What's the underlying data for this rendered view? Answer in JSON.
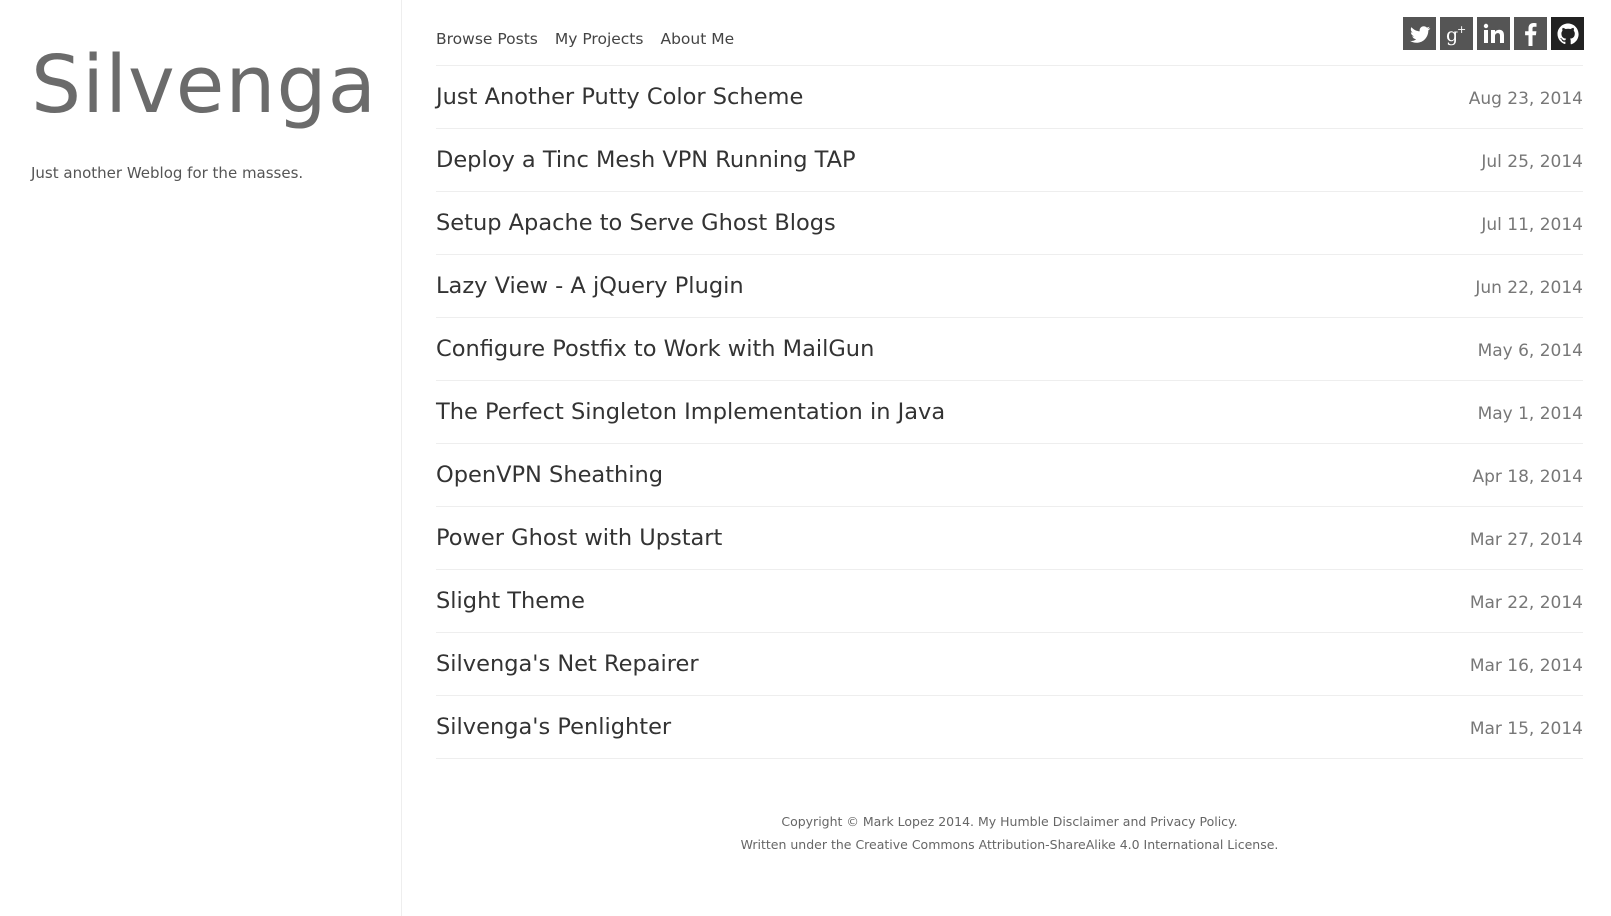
{
  "site": {
    "title": "Silvenga",
    "tagline": "Just another Weblog for the masses."
  },
  "nav": {
    "items": [
      {
        "label": "Browse Posts"
      },
      {
        "label": "My Projects"
      },
      {
        "label": "About Me"
      }
    ]
  },
  "social": {
    "icons": [
      "twitter-icon",
      "google-plus-icon",
      "linkedin-icon",
      "facebook-icon",
      "github-icon"
    ]
  },
  "posts": [
    {
      "title": "Just Another Putty Color Scheme",
      "date": "Aug 23, 2014"
    },
    {
      "title": "Deploy a Tinc Mesh VPN Running TAP",
      "date": "Jul 25, 2014"
    },
    {
      "title": "Setup Apache to Serve Ghost Blogs",
      "date": "Jul 11, 2014"
    },
    {
      "title": "Lazy View - A jQuery Plugin",
      "date": "Jun 22, 2014"
    },
    {
      "title": "Configure Postfix to Work with MailGun",
      "date": "May 6, 2014"
    },
    {
      "title": "The Perfect Singleton Implementation in Java",
      "date": "May 1, 2014"
    },
    {
      "title": "OpenVPN Sheathing",
      "date": "Apr 18, 2014"
    },
    {
      "title": "Power Ghost with Upstart",
      "date": "Mar 27, 2014"
    },
    {
      "title": "Slight Theme",
      "date": "Mar 22, 2014"
    },
    {
      "title": "Silvenga's Net Repairer",
      "date": "Mar 16, 2014"
    },
    {
      "title": "Silvenga's Penlighter",
      "date": "Mar 15, 2014"
    }
  ],
  "footer": {
    "copyright_prefix": "Copyright © Mark Lopez 2014. ",
    "disclaimer_link": "My Humble Disclaimer and Privacy Policy.",
    "license_prefix": "Written under the ",
    "license_link": "Creative Commons Attribution-ShareAlike 4.0 International License."
  },
  "colors": {
    "background": "#ffffff",
    "title": "#6b6b6b",
    "text": "#333333",
    "date": "#777777",
    "divider": "#eeeeee",
    "social_bg": "#555555"
  }
}
